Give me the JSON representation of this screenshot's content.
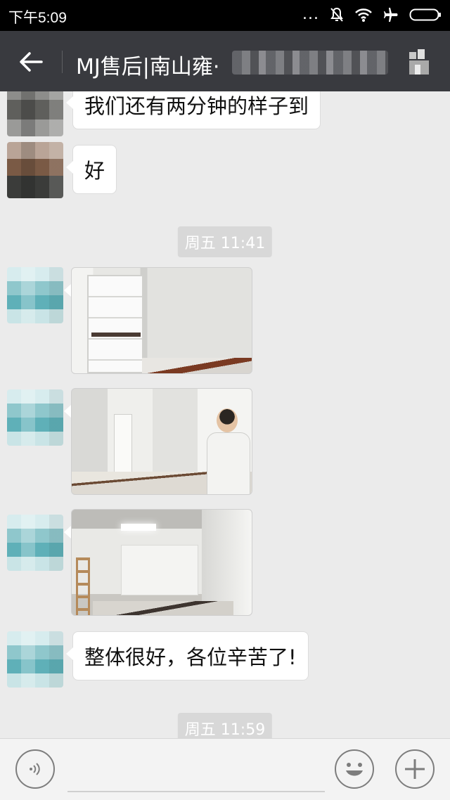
{
  "status_bar": {
    "time": "下午5:09",
    "dots": "..."
  },
  "header": {
    "title": "MJ售后|南山雍·"
  },
  "messages": [
    {
      "type": "text",
      "text": "我们还有两分钟的样子到"
    },
    {
      "type": "text",
      "text": "好"
    },
    {
      "type": "timestamp",
      "text": "周五 11:41"
    },
    {
      "type": "image",
      "subject": "room with wardrobe"
    },
    {
      "type": "image",
      "subject": "hallway with person"
    },
    {
      "type": "image",
      "subject": "living room ceiling light"
    },
    {
      "type": "text",
      "text": "整体很好，各位辛苦了!"
    },
    {
      "type": "timestamp",
      "text": "周五 11:59"
    }
  ],
  "icons": {
    "back": "arrow-left-icon",
    "profile": "profile-icon",
    "voice": "voice-icon",
    "emoji": "emoji-icon",
    "plus": "plus-icon"
  },
  "colors": {
    "header_bg": "#393a3f",
    "chat_bg": "#ebebeb",
    "bubble_bg": "#ffffff",
    "timestamp_bg": "#d8d8d8"
  }
}
